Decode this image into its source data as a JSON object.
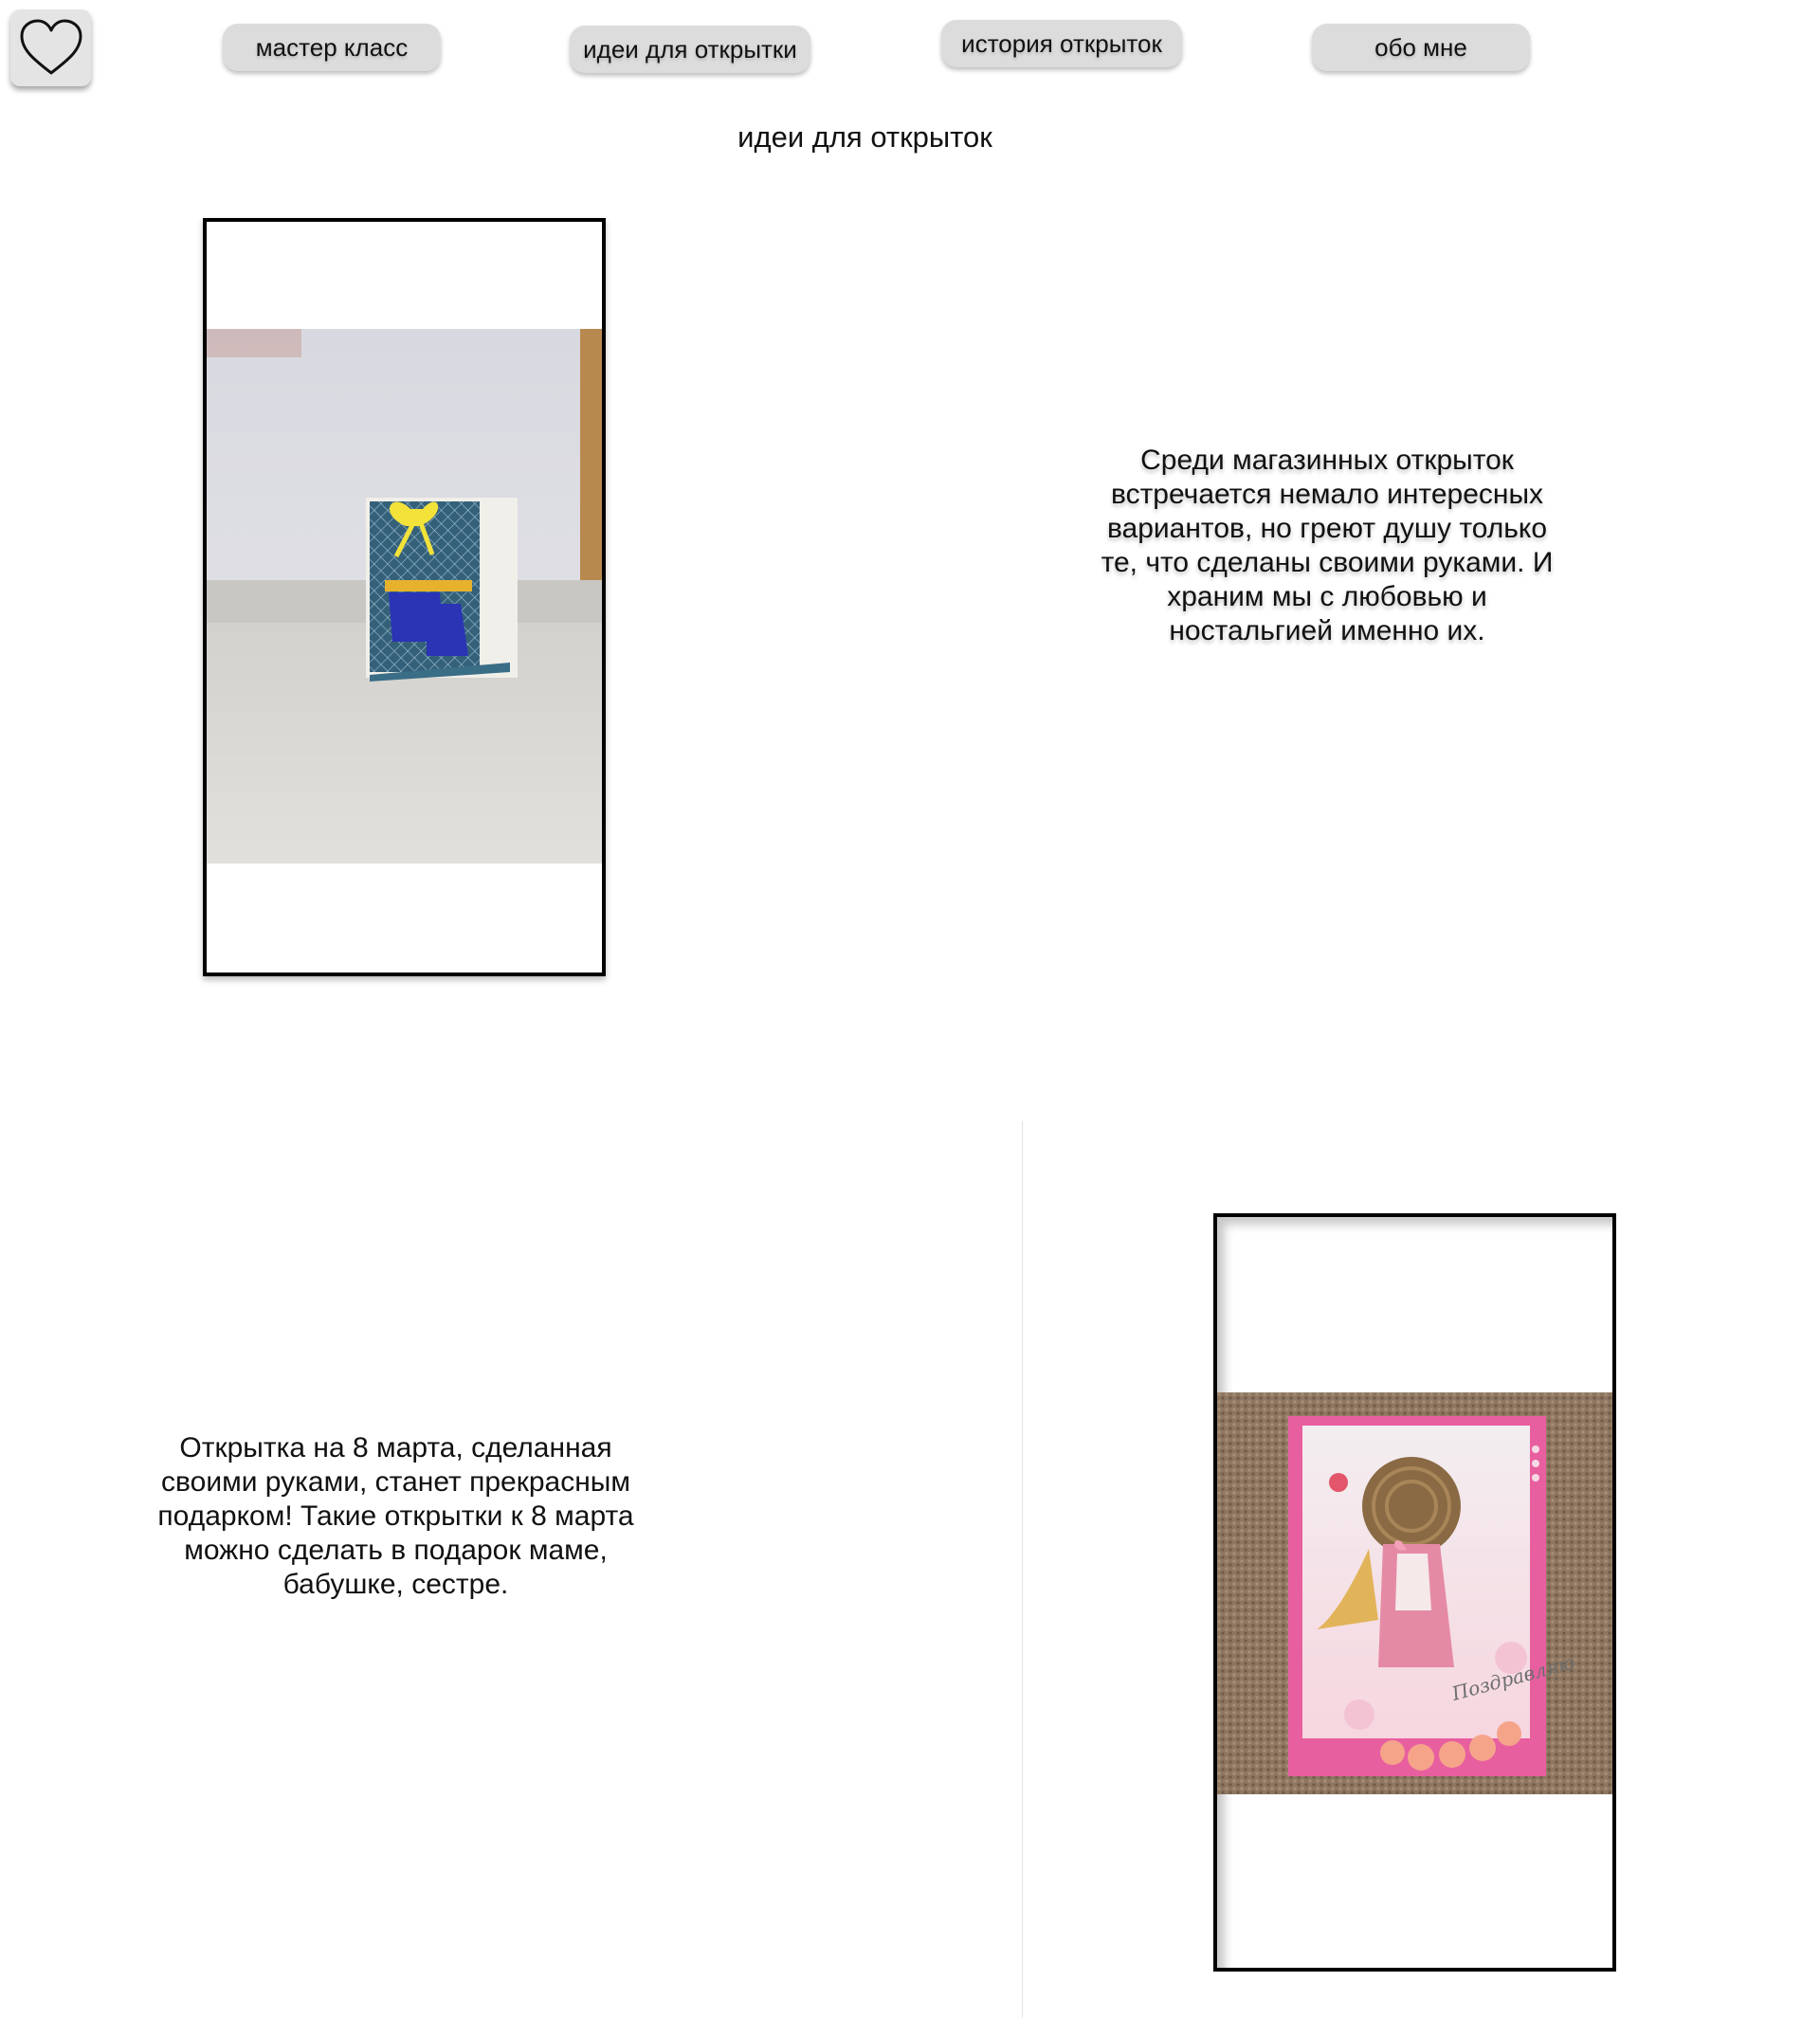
{
  "header": {
    "logo_icon": "heart-outline-icon",
    "nav": [
      {
        "label": "мастер класс"
      },
      {
        "label": "идеи для открытки"
      },
      {
        "label": "история открыток"
      },
      {
        "label": "обо мне"
      }
    ]
  },
  "main": {
    "title": "идеи для открыток",
    "sections": [
      {
        "text": "Среди магазинных открыток встречается немало интересных вариантов, но греют душу только те, что сделаны своими руками. И храним мы с любовью и ностальгией именно их."
      },
      {
        "text": "Открытка на 8 марта, сделанная своими руками, станет прекрасным подарком! Такие открытки к 8 марта можно сделать в подарок маме, бабушке, сестре.",
        "image_caption": "Поздравляю"
      }
    ]
  }
}
